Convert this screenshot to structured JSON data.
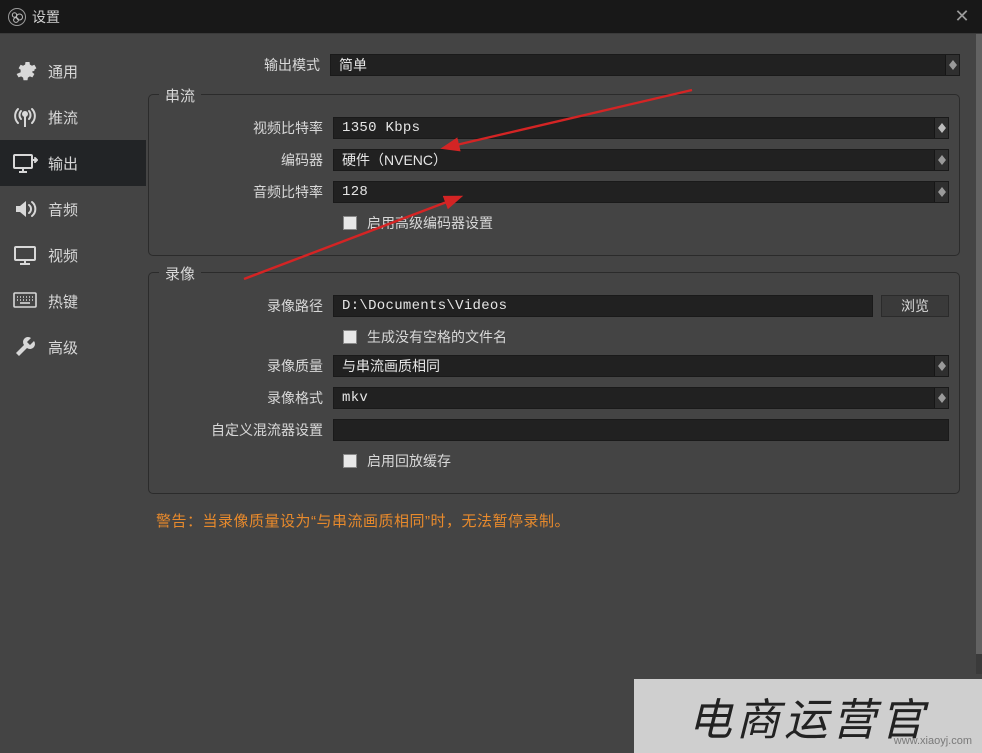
{
  "window": {
    "title": "设置"
  },
  "sidebar": {
    "items": [
      {
        "id": "general",
        "label": "通用"
      },
      {
        "id": "stream",
        "label": "推流"
      },
      {
        "id": "output",
        "label": "输出"
      },
      {
        "id": "audio",
        "label": "音频"
      },
      {
        "id": "video",
        "label": "视频"
      },
      {
        "id": "hotkeys",
        "label": "热键"
      },
      {
        "id": "advanced",
        "label": "高级"
      }
    ]
  },
  "output": {
    "mode_label": "输出模式",
    "mode_value": "简单",
    "stream_group_title": "串流",
    "video_bitrate_label": "视频比特率",
    "video_bitrate_value": "1350 Kbps",
    "encoder_label": "编码器",
    "encoder_value": "硬件（NVENC）",
    "audio_bitrate_label": "音频比特率",
    "audio_bitrate_value": "128",
    "adv_encoder_checkbox_label": "启用高级编码器设置",
    "record_group_title": "录像",
    "record_path_label": "录像路径",
    "record_path_value": "D:\\Documents\\Videos",
    "browse_label": "浏览",
    "filename_nospace_label": "生成没有空格的文件名",
    "record_quality_label": "录像质量",
    "record_quality_value": "与串流画质相同",
    "record_format_label": "录像格式",
    "record_format_value": "mkv",
    "custom_muxer_label": "自定义混流器设置",
    "custom_muxer_value": "",
    "replay_buffer_label": "启用回放缓存"
  },
  "warning": "警告：当录像质量设为“与串流画质相同”时，无法暂停录制。",
  "watermark": {
    "main": "电商运营官",
    "sub": "www.xiaoyj.com"
  }
}
